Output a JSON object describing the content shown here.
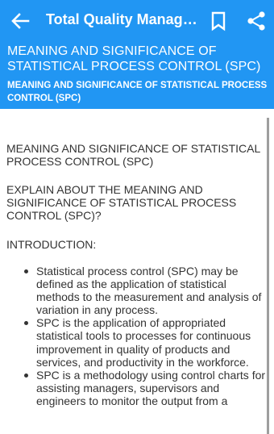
{
  "appbar": {
    "title": "Total Quality Management",
    "back_icon": "arrow-back-icon",
    "bookmark_icon": "bookmark-icon",
    "share_icon": "share-icon",
    "color": "#2196F3"
  },
  "header": {
    "title": "MEANING AND SIGNIFICANCE OF STATISTICAL PROCESS CONTROL (SPC)",
    "subtitle": "MEANING AND SIGNIFICANCE OF STATISTICAL PROCESS CONTROL (SPC)"
  },
  "content": {
    "heading": "MEANING AND SIGNIFICANCE OF STATISTICAL PROCESS CONTROL (SPC)",
    "question": "EXPLAIN ABOUT THE MEANING AND SIGNIFICANCE OF STATISTICAL PROCESS CONTROL (SPC)?",
    "intro_label": "INTRODUCTION:",
    "bullets": [
      "Statistical process control (SPC) may be defined as the application of statistical methods to the measurement and analysis of variation in any process.",
      "SPC is the application of appropriated statistical tools to processes for continuous improvement in quality of products and services, and productivity in the workforce.",
      "SPC is a methodology using control charts for assisting managers, supervisors and engineers to monitor the output from a"
    ]
  }
}
